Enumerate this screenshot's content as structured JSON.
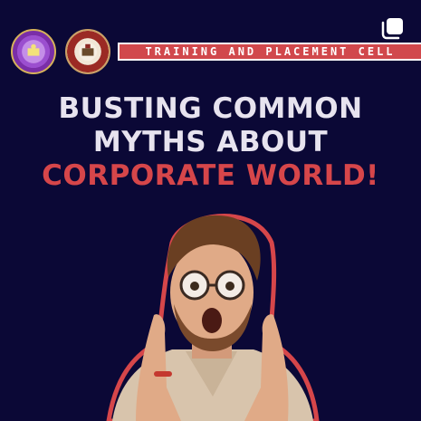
{
  "post": {
    "banner_text": "TRAINING AND PLACEMENT CELL",
    "headline": {
      "line1": "BUSTING COMMON",
      "line2": "MYTHS ABOUT",
      "line3": "CORPORATE WORLD!"
    },
    "colors": {
      "background": "#0b0836",
      "accent": "#d6464a",
      "headline_text": "#e7e3ef"
    },
    "icons": {
      "logo_left": "university-emblem",
      "logo_right": "college-emblem",
      "multi_image": "multiple-images-icon"
    }
  }
}
